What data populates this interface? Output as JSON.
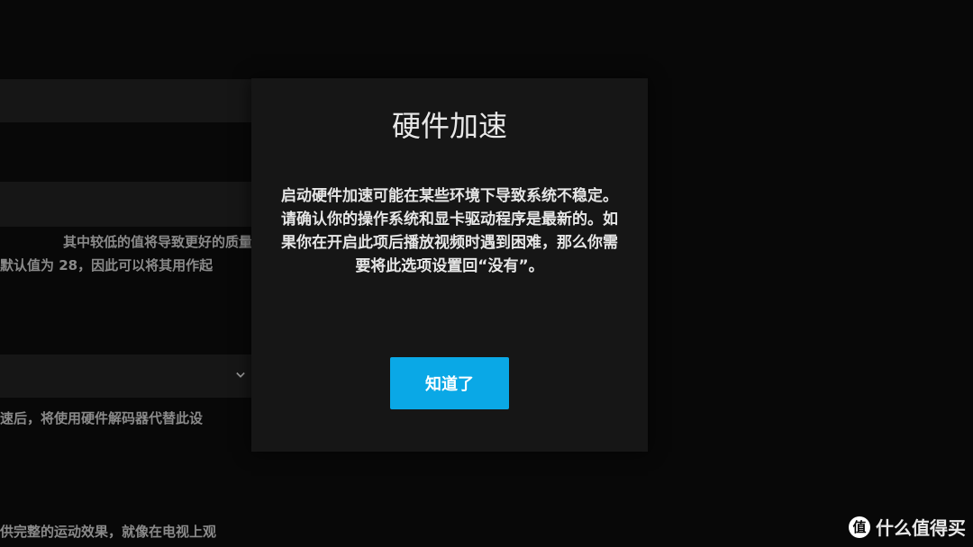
{
  "background": {
    "text_1": "其中较低的值将导致更好的质量",
    "text_2": "默认值为 28，因此可以将其用作起",
    "text_3": "速后，将使用硬件解码器代替此设",
    "text_4": "供完整的运动效果，就像在电视上观",
    "dropdown_icon": "chevron-down-icon"
  },
  "dialog": {
    "title": "硬件加速",
    "body": "启动硬件加速可能在某些环境下导致系统不稳定。请确认你的操作系统和显卡驱动程序是最新的。如果你在开启此项后播放视频时遇到困难，那么你需要将此选项设置回“没有”。",
    "confirm_label": "知道了",
    "accent_color": "#0aa8e6"
  },
  "watermark": {
    "logo_text": "值",
    "text": "什么值得买"
  }
}
